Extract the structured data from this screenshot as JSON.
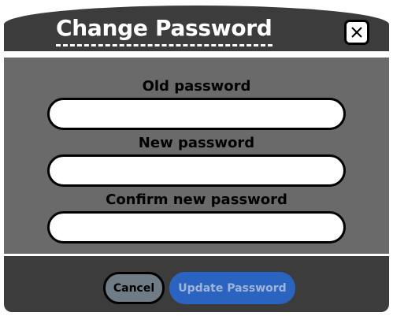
{
  "dialog": {
    "title": "Change Password",
    "close_icon": "close-icon"
  },
  "form": {
    "fields": [
      {
        "label": "Old password",
        "value": "",
        "placeholder": ""
      },
      {
        "label": "New password",
        "value": "",
        "placeholder": ""
      },
      {
        "label": "Confirm new password",
        "value": "",
        "placeholder": ""
      }
    ]
  },
  "footer": {
    "cancel_label": "Cancel",
    "update_label": "Update Password"
  },
  "colors": {
    "header_bg": "#3c3c3c",
    "body_bg": "#6a6a6a",
    "cancel_bg": "#6f7b85",
    "update_bg": "#2a63c0",
    "update_text": "#9fb4d6"
  }
}
